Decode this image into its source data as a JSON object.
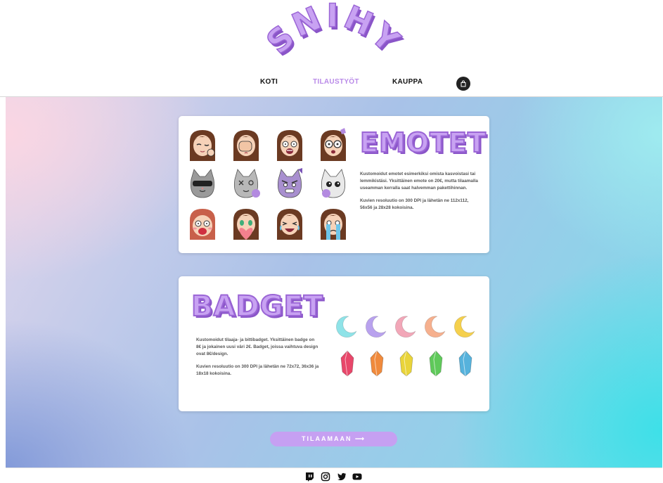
{
  "brand": {
    "logo_text": "SNIHY",
    "accent": "#c8a2f2",
    "accent_dark": "#8a55c8"
  },
  "nav": {
    "items": [
      {
        "label": "KOTI",
        "active": false
      },
      {
        "label": "TILAUSTYÖT",
        "active": true
      },
      {
        "label": "KAUPPA",
        "active": false
      }
    ],
    "cart_icon": "shopping-bag-icon"
  },
  "emotet": {
    "heading": "EMOTET",
    "paragraphs": [
      "Kustomoidut emotet esimerkiksi omista kasvoistasi tai lemmikistäsi. Yksittäinen emote on 20€, mutta tilaamalla useamman kerralla saat halvemman pakettihinnan.",
      "Kuvien resoluutio on 300 DPI ja lähetän ne 112x112, 56x56 ja 28x28 kokoisina."
    ],
    "emote_icons": [
      "girl-wink-emote",
      "girl-facepalm-emote",
      "girl-shocked-emote",
      "girl-glasses-emote",
      "cat-sunglasses-emote",
      "cat-dizzy-emote",
      "cat-angry-emote",
      "cat-plush-emote",
      "girl-blush-scream-emote",
      "girl-heart-emote",
      "girl-laugh-emote",
      "girl-cry-emote"
    ]
  },
  "badget": {
    "heading": "BADGET",
    "paragraphs": [
      "Kustomoidut tilaaja- ja bittibadget. Yksittäinen badge on 8€ ja jokainen uusi väri 2€. Badget, joissa vaihtuva design ovat 8€/design.",
      "Kuvien resoluutio on 300 DPI ja lähetän ne 72x72, 36x36 ja 18x18 kokoisina."
    ],
    "moon_colors": [
      "#8fe3e8",
      "#b9a2ee",
      "#f2a7b8",
      "#f6b08e",
      "#f5d04d"
    ],
    "crystal_colors": [
      "#e8476a",
      "#f08a3c",
      "#e9d43a",
      "#5fc95a",
      "#56b2dc"
    ]
  },
  "cta": {
    "label": "TILAAMAAN ⟶"
  },
  "footer": {
    "social_icons": [
      "twitch-icon",
      "instagram-icon",
      "twitter-icon",
      "youtube-icon"
    ]
  }
}
